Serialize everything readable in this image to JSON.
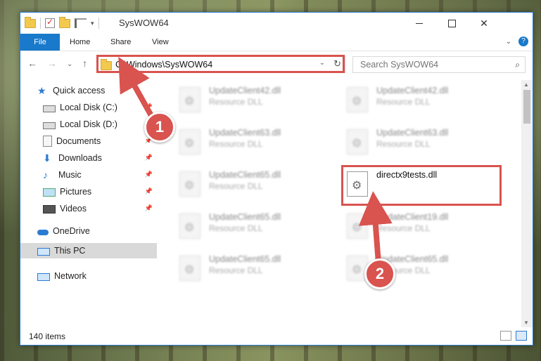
{
  "window": {
    "title": "SysWOW64"
  },
  "ribbon": {
    "tabs": [
      "File",
      "Home",
      "Share",
      "View"
    ],
    "help": "?"
  },
  "address": {
    "path": "C:\\Windows\\SysWOW64"
  },
  "search": {
    "placeholder": "Search SysWOW64"
  },
  "sidebar": {
    "items": [
      {
        "label": "Quick access",
        "icon": "star-icon",
        "pinned": false
      },
      {
        "label": "Local Disk (C:)",
        "icon": "drive-icon",
        "pinned": true
      },
      {
        "label": "Local Disk (D:)",
        "icon": "drive-icon",
        "pinned": true
      },
      {
        "label": "Documents",
        "icon": "documents-icon",
        "pinned": true
      },
      {
        "label": "Downloads",
        "icon": "downloads-icon",
        "pinned": true
      },
      {
        "label": "Music",
        "icon": "music-icon",
        "pinned": true
      },
      {
        "label": "Pictures",
        "icon": "pictures-icon",
        "pinned": true
      },
      {
        "label": "Videos",
        "icon": "videos-icon",
        "pinned": true
      },
      {
        "label": "OneDrive",
        "icon": "onedrive-icon",
        "pinned": false
      },
      {
        "label": "This PC",
        "icon": "this-pc-icon",
        "pinned": false
      },
      {
        "label": "Network",
        "icon": "network-icon",
        "pinned": false
      }
    ]
  },
  "files": [
    {
      "name": "UpdateClient42.dll",
      "type": "Resource DLL"
    },
    {
      "name": "UpdateClient42.dll",
      "type": "Resource DLL"
    },
    {
      "name": "UpdateClient63.dll",
      "type": "Resource DLL"
    },
    {
      "name": "UpdateClient63.dll",
      "type": "Resource DLL"
    },
    {
      "name": "UpdateClient65.dll",
      "type": "Resource DLL"
    },
    {
      "name": "directx9tests.dll",
      "type": ""
    },
    {
      "name": "UpdateClient65.dll",
      "type": "Resource DLL"
    },
    {
      "name": "UpdateClient19.dll",
      "type": "Resource DLL"
    },
    {
      "name": "UpdateClient65.dll",
      "type": "Resource DLL"
    },
    {
      "name": "UpdateClient65.dll",
      "type": "Resource DLL"
    }
  ],
  "status": {
    "items": "140 items"
  },
  "annotations": {
    "badge1": "1",
    "badge2": "2"
  },
  "colors": {
    "accent": "#1979ca",
    "highlight": "#d9534f"
  }
}
